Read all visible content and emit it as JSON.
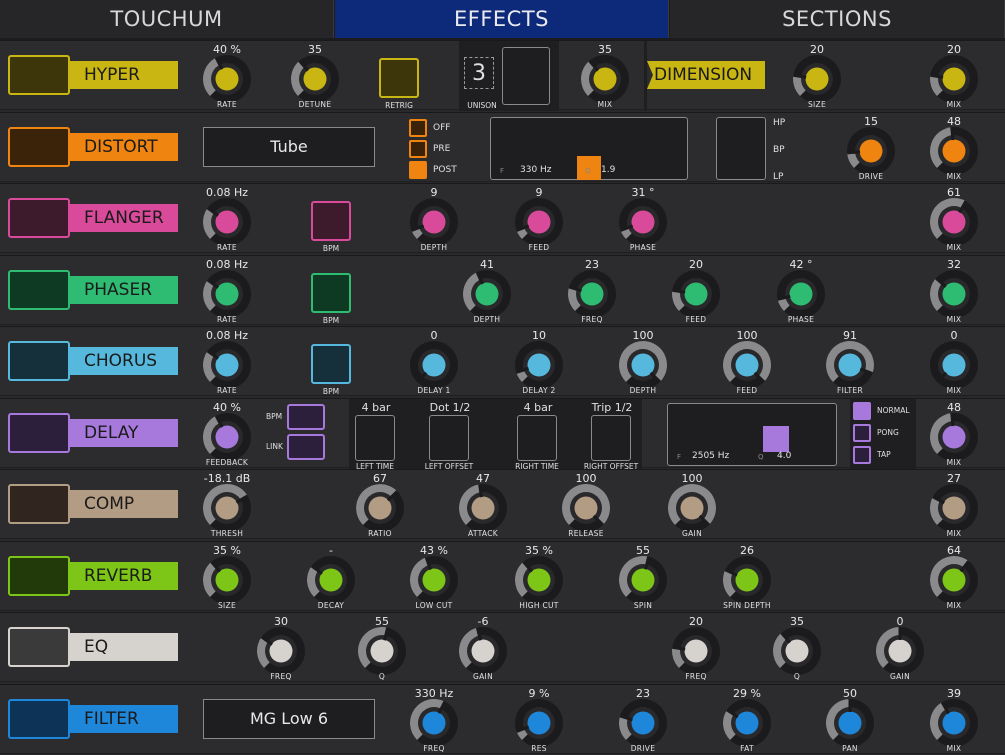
{
  "tabs": [
    "TOUCHUM",
    "EFFECTS",
    "SECTIONS"
  ],
  "active_tab": "EFFECTS",
  "rows": [
    {
      "name": "HYPER",
      "color": "#c9b612",
      "swatch": "#3d360a"
    },
    {
      "name": "DISTORT",
      "color": "#ef8410",
      "swatch": "#3a2308"
    },
    {
      "name": "FLANGER",
      "color": "#d94b9a",
      "swatch": "#3e1a2d"
    },
    {
      "name": "PHASER",
      "color": "#2ebc72",
      "swatch": "#0e3a24"
    },
    {
      "name": "CHORUS",
      "color": "#55b8dc",
      "swatch": "#152f3b"
    },
    {
      "name": "DELAY",
      "color": "#a879dc",
      "swatch": "#2c1f3c"
    },
    {
      "name": "COMP",
      "color": "#b39c84",
      "swatch": "#30261f"
    },
    {
      "name": "REVERB",
      "color": "#7dc617",
      "swatch": "#223a09"
    },
    {
      "name": "EQ",
      "color": "#d6d3cf",
      "swatch": "#3a3a3a"
    },
    {
      "name": "FILTER",
      "color": "#1f87da",
      "swatch": "#0d3356"
    }
  ],
  "hyper": {
    "rate": {
      "value": "40 %",
      "label": "RATE",
      "level": 0.4
    },
    "detune": {
      "value": "35",
      "label": "DETUNE",
      "level": 0.35
    },
    "retrig_label": "RETRIG",
    "unison_value": "3",
    "unison_label": "UNISON",
    "mix": {
      "value": "35",
      "label": "MIX",
      "level": 0.35
    }
  },
  "dimension": {
    "name": "DIMENSION",
    "size": {
      "value": "20",
      "label": "SIZE",
      "level": 0.2
    },
    "mix": {
      "value": "20",
      "label": "MIX",
      "level": 0.2
    }
  },
  "distort": {
    "type": "Tube",
    "options": [
      "OFF",
      "PRE",
      "POST"
    ],
    "selected_option": "POST",
    "freq_label": "F",
    "freq_value": "330 Hz",
    "q_label": "Q",
    "q_value": "1.9",
    "filter_modes": [
      "HP",
      "BP",
      "LP"
    ],
    "drive": {
      "value": "15",
      "label": "DRIVE",
      "level": 0.15
    },
    "mix": {
      "value": "48",
      "label": "MIX",
      "level": 0.48
    }
  },
  "flanger": {
    "rate": {
      "value": "0.08  Hz",
      "label": "RATE",
      "level": 0.3
    },
    "bpm_label": "BPM",
    "depth": {
      "value": "9",
      "label": "DEPTH",
      "level": 0.09
    },
    "feed": {
      "value": "9",
      "label": "FEED",
      "level": 0.09
    },
    "phase": {
      "value": "31 °",
      "label": "PHASE",
      "level": 0.09
    },
    "mix": {
      "value": "61",
      "label": "MIX",
      "level": 0.61
    }
  },
  "phaser": {
    "rate": {
      "value": "0.08  Hz",
      "label": "RATE",
      "level": 0.3
    },
    "bpm_label": "BPM",
    "depth": {
      "value": "41",
      "label": "DEPTH",
      "level": 0.41
    },
    "freq": {
      "value": "23",
      "label": "FREQ",
      "level": 0.23
    },
    "feed": {
      "value": "20",
      "label": "FEED",
      "level": 0.2
    },
    "phase": {
      "value": "42 °",
      "label": "PHASE",
      "level": 0.12
    },
    "mix": {
      "value": "32",
      "label": "MIX",
      "level": 0.32
    }
  },
  "chorus": {
    "rate": {
      "value": "0.08  Hz",
      "label": "RATE",
      "level": 0.3
    },
    "bpm_label": "BPM",
    "delay1": {
      "value": "0",
      "label": "DELAY 1",
      "level": 0.0
    },
    "delay2": {
      "value": "10",
      "label": "DELAY 2",
      "level": 0.1
    },
    "depth": {
      "value": "100",
      "label": "DEPTH",
      "level": 1.0
    },
    "feed": {
      "value": "100",
      "label": "FEED",
      "level": 1.0
    },
    "filter": {
      "value": "91",
      "label": "FILTER",
      "level": 0.91
    },
    "mix": {
      "value": "0",
      "label": "MIX",
      "level": 0.0
    }
  },
  "delay": {
    "feedback": {
      "value": "40 %",
      "label": "FEEDBACK",
      "level": 0.4
    },
    "bpm_label": "BPM",
    "link_label": "LINK",
    "left_time_value": "4 bar",
    "left_time_label": "LEFT TIME",
    "left_offset_value": "Dot 1/2",
    "left_offset_label": "LEFT OFFSET",
    "right_time_value": "4 bar",
    "right_time_label": "RIGHT TIME",
    "right_offset_value": "Trip 1/2",
    "right_offset_label": "RIGHT OFFSET",
    "freq_label": "F",
    "freq_value": "2505 Hz",
    "q_label": "Q",
    "q_value": "4.0",
    "modes": [
      "NORMAL",
      "PONG",
      "TAP"
    ],
    "selected_mode": "NORMAL",
    "mix": {
      "value": "48",
      "label": "MIX",
      "level": 0.48
    }
  },
  "comp": {
    "thresh": {
      "value": "-18.1  dB",
      "label": "THRESH",
      "level": 0.72
    },
    "ratio": {
      "value": "67",
      "label": "RATIO",
      "level": 0.67
    },
    "attack": {
      "value": "47",
      "label": "ATTACK",
      "level": 0.47
    },
    "release": {
      "value": "100",
      "label": "RELEASE",
      "level": 1.0
    },
    "gain": {
      "value": "100",
      "label": "GAIN",
      "level": 1.0
    },
    "mix": {
      "value": "27",
      "label": "MIX",
      "level": 0.27
    }
  },
  "reverb": {
    "size": {
      "value": "35 %",
      "label": "SIZE",
      "level": 0.35
    },
    "decay": {
      "value": "-",
      "label": "DECAY",
      "level": 0.3
    },
    "low_cut": {
      "value": "43 %",
      "label": "LOW CUT",
      "level": 0.43
    },
    "high_cut": {
      "value": "35 %",
      "label": "HIGH CUT",
      "level": 0.35
    },
    "spin": {
      "value": "55",
      "label": "SPIN",
      "level": 0.55
    },
    "spin_depth": {
      "value": "26",
      "label": "SPIN DEPTH",
      "level": 0.26
    },
    "mix": {
      "value": "64",
      "label": "MIX",
      "level": 0.64
    }
  },
  "eq": {
    "freq1": {
      "value": "30",
      "label": "FREQ",
      "level": 0.3
    },
    "q1": {
      "value": "55",
      "label": "Q",
      "level": 0.55
    },
    "gain1": {
      "value": "-6",
      "label": "GAIN",
      "level": 0.45
    },
    "freq2": {
      "value": "20",
      "label": "FREQ",
      "level": 0.2
    },
    "q2": {
      "value": "35",
      "label": "Q",
      "level": 0.35
    },
    "gain2": {
      "value": "0",
      "label": "GAIN",
      "level": 0.5
    }
  },
  "filter": {
    "type": "MG Low 6",
    "freq": {
      "value": "330  Hz",
      "label": "FREQ",
      "level": 0.6
    },
    "res": {
      "value": "9 %",
      "label": "RES",
      "level": 0.09
    },
    "drive": {
      "value": "23",
      "label": "DRIVE",
      "level": 0.23
    },
    "fat": {
      "value": "29 %",
      "label": "FAT",
      "level": 0.29
    },
    "pan": {
      "value": "50",
      "label": "PAN",
      "level": 0.5
    },
    "mix": {
      "value": "39",
      "label": "MIX",
      "level": 0.39
    }
  }
}
